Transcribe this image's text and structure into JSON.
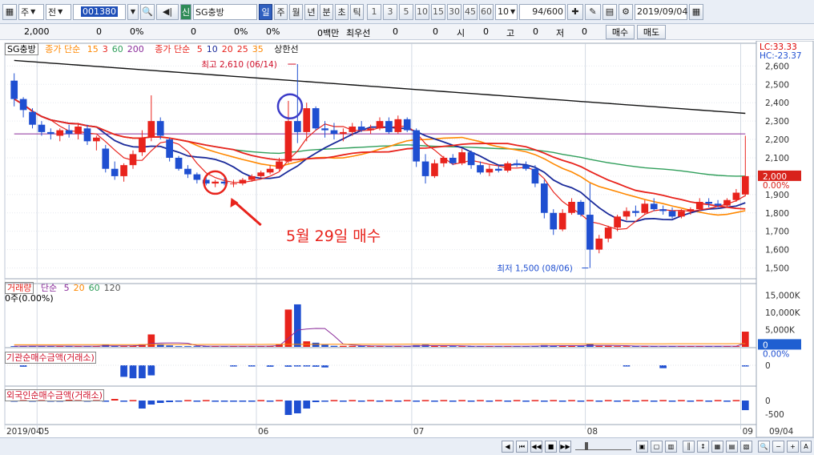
{
  "toolbar": {
    "type_select": "주",
    "prev_label": "전",
    "code": "001380",
    "name_tag": "신",
    "stock_name": "SG충방",
    "periods": [
      "일",
      "주",
      "월",
      "년",
      "분",
      "초",
      "틱"
    ],
    "active_period": "일",
    "numbers": [
      "1",
      "3",
      "5",
      "10",
      "15",
      "30",
      "45",
      "60"
    ],
    "interval_value": "10",
    "count": "94",
    "count_total": "/600",
    "date": "2019/09/04"
  },
  "infobar": {
    "price": "2,000",
    "change": "0",
    "change_pct": "0%",
    "volume": "0",
    "volume_pct": "0%",
    "vol_ratio": "0%",
    "amount": "0백만",
    "priority_label": "최우선",
    "priority_a": "0",
    "priority_b": "0",
    "open_label": "시",
    "open": "0",
    "high_label": "고",
    "high": "0",
    "low_label": "저",
    "low": "0",
    "buy_label": "매수",
    "sell_label": "매도"
  },
  "price_legend": {
    "name": "SG충방",
    "ma_close_label": "종가 단순",
    "ma_close_periods": [
      "15",
      "3",
      "60",
      "200"
    ],
    "ma_close2_label": "종가 단순",
    "ma_close2_periods": [
      "5",
      "10",
      "20",
      "25",
      "35"
    ],
    "upper_limit_label": "상한선"
  },
  "corner_labels": {
    "lc": "LC:33.33",
    "hc": "HC:-23.37"
  },
  "price_axis": [
    "2,600",
    "2,500",
    "2,400",
    "2,300",
    "2,200",
    "2,100",
    "2,000",
    "1,900",
    "1,800",
    "1,700",
    "1,600",
    "1,500"
  ],
  "price_current_box": "2,000",
  "price_current_pct": "0.00%",
  "annotations": {
    "high": "최고 2,610 (06/14)",
    "low": "최저 1,500 (08/06)",
    "buy_note": "5월 29일 매수"
  },
  "volume_legend": {
    "title": "거래량",
    "ma_label": "단순",
    "periods": [
      "5",
      "20",
      "60",
      "120"
    ],
    "sub": "0주(0.00%)"
  },
  "volume_axis": [
    "15,000K",
    "10,000K",
    "5,000K"
  ],
  "volume_box": "0",
  "volume_pct": "0.00%",
  "inst_legend": "기관순매수금액(거래소)",
  "inst_axis": [
    "0"
  ],
  "foreign_legend": "외국인순매수금액(거래소)",
  "foreign_axis": [
    "0",
    "-500"
  ],
  "x_axis": [
    "2019/04",
    "05",
    "06",
    "07",
    "08",
    "09",
    "09/04"
  ],
  "colors": {
    "up": "#e8231c",
    "down": "#1f4fd1",
    "ma5": "#e8231c",
    "ma10": "#1a2a9a",
    "ma20": "#ff8800",
    "ma60": "#2f9e5a",
    "ma120": "#111111",
    "upper": "#8a2b9a"
  },
  "chart_data": {
    "type": "candlestick",
    "ylim": [
      1450,
      2680
    ],
    "candles": [
      {
        "o": 2520,
        "h": 2560,
        "l": 2380,
        "c": 2420
      },
      {
        "o": 2420,
        "h": 2430,
        "l": 2320,
        "c": 2360
      },
      {
        "o": 2350,
        "h": 2370,
        "l": 2260,
        "c": 2280
      },
      {
        "o": 2280,
        "h": 2300,
        "l": 2220,
        "c": 2240
      },
      {
        "o": 2240,
        "h": 2260,
        "l": 2200,
        "c": 2230
      },
      {
        "o": 2220,
        "h": 2260,
        "l": 2190,
        "c": 2250
      },
      {
        "o": 2250,
        "h": 2280,
        "l": 2210,
        "c": 2230
      },
      {
        "o": 2230,
        "h": 2290,
        "l": 2200,
        "c": 2270
      },
      {
        "o": 2260,
        "h": 2280,
        "l": 2170,
        "c": 2190
      },
      {
        "o": 2190,
        "h": 2220,
        "l": 2140,
        "c": 2210
      },
      {
        "o": 2150,
        "h": 2170,
        "l": 2020,
        "c": 2040
      },
      {
        "o": 2040,
        "h": 2080,
        "l": 1980,
        "c": 2000
      },
      {
        "o": 2000,
        "h": 2070,
        "l": 1970,
        "c": 2060
      },
      {
        "o": 2060,
        "h": 2140,
        "l": 2040,
        "c": 2120
      },
      {
        "o": 2130,
        "h": 2250,
        "l": 2110,
        "c": 2210
      },
      {
        "o": 2210,
        "h": 2440,
        "l": 2190,
        "c": 2300
      },
      {
        "o": 2300,
        "h": 2320,
        "l": 2200,
        "c": 2220
      },
      {
        "o": 2200,
        "h": 2210,
        "l": 2080,
        "c": 2100
      },
      {
        "o": 2100,
        "h": 2110,
        "l": 2030,
        "c": 2040
      },
      {
        "o": 2040,
        "h": 2060,
        "l": 1990,
        "c": 2010
      },
      {
        "o": 2010,
        "h": 2020,
        "l": 1960,
        "c": 1980
      },
      {
        "o": 1980,
        "h": 2000,
        "l": 1950,
        "c": 1960
      },
      {
        "o": 1960,
        "h": 1980,
        "l": 1940,
        "c": 1970
      },
      {
        "o": 1970,
        "h": 1990,
        "l": 1950,
        "c": 1960
      },
      {
        "o": 1960,
        "h": 1980,
        "l": 1940,
        "c": 1960
      },
      {
        "o": 1960,
        "h": 1990,
        "l": 1950,
        "c": 1980
      },
      {
        "o": 1980,
        "h": 2010,
        "l": 1970,
        "c": 2000
      },
      {
        "o": 2000,
        "h": 2030,
        "l": 1990,
        "c": 2020
      },
      {
        "o": 2020,
        "h": 2060,
        "l": 2010,
        "c": 2040
      },
      {
        "o": 2040,
        "h": 2100,
        "l": 2030,
        "c": 2080
      },
      {
        "o": 2080,
        "h": 2410,
        "l": 2070,
        "c": 2300
      },
      {
        "o": 2300,
        "h": 2610,
        "l": 2180,
        "c": 2240
      },
      {
        "o": 2240,
        "h": 2400,
        "l": 2190,
        "c": 2370
      },
      {
        "o": 2370,
        "h": 2380,
        "l": 2250,
        "c": 2260
      },
      {
        "o": 2260,
        "h": 2300,
        "l": 2210,
        "c": 2250
      },
      {
        "o": 2250,
        "h": 2290,
        "l": 2200,
        "c": 2230
      },
      {
        "o": 2230,
        "h": 2260,
        "l": 2190,
        "c": 2240
      },
      {
        "o": 2240,
        "h": 2290,
        "l": 2220,
        "c": 2270
      },
      {
        "o": 2270,
        "h": 2300,
        "l": 2240,
        "c": 2250
      },
      {
        "o": 2250,
        "h": 2280,
        "l": 2230,
        "c": 2260
      },
      {
        "o": 2260,
        "h": 2320,
        "l": 2250,
        "c": 2300
      },
      {
        "o": 2300,
        "h": 2320,
        "l": 2230,
        "c": 2240
      },
      {
        "o": 2240,
        "h": 2330,
        "l": 2230,
        "c": 2310
      },
      {
        "o": 2310,
        "h": 2320,
        "l": 2240,
        "c": 2250
      },
      {
        "o": 2250,
        "h": 2260,
        "l": 2050,
        "c": 2080
      },
      {
        "o": 2080,
        "h": 2120,
        "l": 1960,
        "c": 2000
      },
      {
        "o": 2000,
        "h": 2090,
        "l": 1990,
        "c": 2070
      },
      {
        "o": 2070,
        "h": 2110,
        "l": 2050,
        "c": 2100
      },
      {
        "o": 2100,
        "h": 2120,
        "l": 2060,
        "c": 2070
      },
      {
        "o": 2070,
        "h": 2150,
        "l": 2060,
        "c": 2130
      },
      {
        "o": 2130,
        "h": 2140,
        "l": 2040,
        "c": 2060
      },
      {
        "o": 2060,
        "h": 2080,
        "l": 2010,
        "c": 2020
      },
      {
        "o": 2020,
        "h": 2060,
        "l": 2000,
        "c": 2040
      },
      {
        "o": 2040,
        "h": 2060,
        "l": 2020,
        "c": 2030
      },
      {
        "o": 2030,
        "h": 2080,
        "l": 2020,
        "c": 2070
      },
      {
        "o": 2070,
        "h": 2090,
        "l": 2050,
        "c": 2060
      },
      {
        "o": 2060,
        "h": 2080,
        "l": 2030,
        "c": 2040
      },
      {
        "o": 2040,
        "h": 2060,
        "l": 1940,
        "c": 1960
      },
      {
        "o": 1960,
        "h": 1980,
        "l": 1770,
        "c": 1800
      },
      {
        "o": 1800,
        "h": 1820,
        "l": 1680,
        "c": 1710
      },
      {
        "o": 1710,
        "h": 1820,
        "l": 1700,
        "c": 1800
      },
      {
        "o": 1800,
        "h": 1880,
        "l": 1790,
        "c": 1860
      },
      {
        "o": 1860,
        "h": 1870,
        "l": 1780,
        "c": 1790
      },
      {
        "o": 1790,
        "h": 1960,
        "l": 1500,
        "c": 1600
      },
      {
        "o": 1600,
        "h": 1680,
        "l": 1580,
        "c": 1660
      },
      {
        "o": 1660,
        "h": 1730,
        "l": 1640,
        "c": 1720
      },
      {
        "o": 1720,
        "h": 1790,
        "l": 1700,
        "c": 1780
      },
      {
        "o": 1780,
        "h": 1830,
        "l": 1760,
        "c": 1810
      },
      {
        "o": 1810,
        "h": 1840,
        "l": 1780,
        "c": 1800
      },
      {
        "o": 1800,
        "h": 1870,
        "l": 1790,
        "c": 1850
      },
      {
        "o": 1850,
        "h": 1880,
        "l": 1810,
        "c": 1820
      },
      {
        "o": 1820,
        "h": 1840,
        "l": 1790,
        "c": 1810
      },
      {
        "o": 1810,
        "h": 1830,
        "l": 1770,
        "c": 1780
      },
      {
        "o": 1780,
        "h": 1820,
        "l": 1770,
        "c": 1810
      },
      {
        "o": 1810,
        "h": 1830,
        "l": 1790,
        "c": 1820
      },
      {
        "o": 1820,
        "h": 1880,
        "l": 1810,
        "c": 1860
      },
      {
        "o": 1860,
        "h": 1880,
        "l": 1830,
        "c": 1850
      },
      {
        "o": 1850,
        "h": 1870,
        "l": 1830,
        "c": 1840
      },
      {
        "o": 1840,
        "h": 1880,
        "l": 1830,
        "c": 1870
      },
      {
        "o": 1870,
        "h": 1930,
        "l": 1860,
        "c": 1910
      },
      {
        "o": 1900,
        "h": 2220,
        "l": 1890,
        "c": 2000
      }
    ],
    "volumes": [
      0.2,
      0.2,
      0.3,
      0.2,
      0.2,
      0.2,
      0.2,
      0.2,
      0.2,
      0.2,
      0.6,
      0.3,
      0.2,
      0.3,
      0.6,
      3.6,
      0.8,
      0.4,
      0.2,
      0.2,
      0.2,
      0.2,
      0.2,
      0.2,
      0.2,
      0.2,
      0.2,
      0.2,
      0.3,
      0.8,
      10.8,
      12.3,
      1.6,
      1.2,
      0.6,
      0.3,
      0.3,
      0.3,
      0.3,
      0.2,
      0.2,
      0.2,
      0.2,
      0.2,
      0.5,
      0.6,
      0.3,
      0.2,
      0.2,
      0.2,
      0.2,
      0.2,
      0.2,
      0.2,
      0.2,
      0.2,
      0.2,
      0.3,
      0.5,
      0.4,
      0.3,
      0.3,
      0.3,
      0.8,
      0.3,
      0.3,
      0.2,
      0.2,
      0.2,
      0.2,
      0.2,
      0.2,
      0.2,
      0.2,
      0.2,
      0.2,
      0.2,
      0.2,
      0.2,
      0.2,
      4.4
    ],
    "institution": [
      0,
      -2,
      0,
      0,
      0,
      0,
      0,
      0,
      0,
      0,
      0,
      0,
      -16,
      -18,
      -18,
      -14,
      0,
      0,
      0,
      0,
      0,
      0,
      0,
      0,
      -1,
      0,
      -1,
      0,
      -2,
      0,
      -2,
      -1,
      -1,
      -2,
      -3,
      0,
      0,
      0,
      0,
      0,
      0,
      0,
      0,
      0,
      0,
      0,
      0,
      0,
      0,
      0,
      0,
      0,
      0,
      0,
      0,
      0,
      0,
      0,
      0,
      0,
      0,
      0,
      0,
      0,
      0,
      0,
      0,
      -1,
      0,
      0,
      0,
      -4,
      0,
      0,
      0,
      0,
      0,
      0,
      0,
      0,
      -1
    ],
    "foreign": [
      0,
      0,
      0,
      0,
      0,
      -1,
      1,
      0,
      0,
      0,
      0,
      2,
      0,
      0,
      -10,
      -5,
      -3,
      -2,
      0,
      0,
      0,
      0,
      0,
      -1,
      0,
      -1,
      0,
      0,
      -1,
      0,
      -18,
      -16,
      -10,
      -2,
      0,
      0,
      0,
      0,
      0,
      0,
      0,
      0,
      0,
      0,
      0,
      0,
      0,
      0,
      0,
      0,
      0,
      0,
      0,
      0,
      0,
      0,
      0,
      0,
      0,
      0,
      0,
      0,
      0,
      0,
      0,
      0,
      0,
      0,
      0,
      0,
      0,
      0,
      0,
      0,
      0,
      0,
      0,
      0,
      0,
      0,
      -12
    ]
  }
}
